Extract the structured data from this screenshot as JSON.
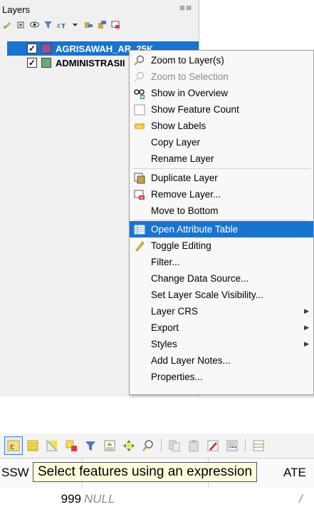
{
  "layers_panel": {
    "title": "Layers",
    "window_controls": "⊠⊠",
    "toolbar_icons": [
      "open-layer-styling-icon",
      "add-group-icon",
      "manage-map-themes-icon",
      "filter-legend-icon",
      "filter-by-expression-icon",
      "expand-all-icon",
      "collapse-all-icon",
      "remove-layer-icon"
    ],
    "layers": [
      {
        "name": "AGRISAWAH_AR_25K",
        "checked": true,
        "swatch_color": "#9b4f96",
        "selected": true
      },
      {
        "name": "ADMINISTRASII",
        "checked": true,
        "swatch_color": "#6cab73",
        "selected": false
      }
    ]
  },
  "context_menu": {
    "items": [
      {
        "label": "Zoom to Layer(s)",
        "icon": "zoom-layer-icon",
        "disabled": false
      },
      {
        "label": "Zoom to Selection",
        "icon": "zoom-selection-icon",
        "disabled": true
      },
      {
        "label": "Show in Overview",
        "icon": "overview-icon",
        "disabled": false
      },
      {
        "label": "Show Feature Count",
        "icon": "checkbox-icon",
        "disabled": false
      },
      {
        "label": "Show Labels",
        "icon": "labels-icon",
        "disabled": false
      },
      {
        "label": "Copy Layer",
        "icon": "",
        "disabled": false
      },
      {
        "label": "Rename Layer",
        "icon": "",
        "disabled": false
      },
      {
        "label": "Duplicate Layer",
        "icon": "duplicate-icon",
        "disabled": false
      },
      {
        "label": "Remove Layer...",
        "icon": "remove-layer-icon",
        "disabled": false
      },
      {
        "label": "Move to Bottom",
        "icon": "",
        "disabled": false
      },
      {
        "label": "Open Attribute Table",
        "icon": "attribute-table-icon",
        "disabled": false,
        "highlighted": true
      },
      {
        "label": "Toggle Editing",
        "icon": "pencil-icon",
        "disabled": false
      },
      {
        "label": "Filter...",
        "icon": "",
        "disabled": false
      },
      {
        "label": "Change Data Source...",
        "icon": "",
        "disabled": false
      },
      {
        "label": "Set Layer Scale Visibility...",
        "icon": "",
        "disabled": false
      },
      {
        "label": "Layer CRS",
        "icon": "",
        "disabled": false,
        "submenu": true
      },
      {
        "label": "Export",
        "icon": "",
        "disabled": false,
        "submenu": true
      },
      {
        "label": "Styles",
        "icon": "",
        "disabled": false,
        "submenu": true
      },
      {
        "label": "Add Layer Notes...",
        "icon": "",
        "disabled": false
      },
      {
        "label": "Properties...",
        "icon": "",
        "disabled": false
      }
    ],
    "submenu_arrow": "▶"
  },
  "attribute_table": {
    "toolbar_icons": [
      "select-by-expression-icon",
      "select-all-icon",
      "invert-selection-icon",
      "deselect-all-icon",
      "filter-select-icon",
      "move-selection-top-icon",
      "pan-to-selection-icon",
      "zoom-to-selection-icon",
      "copy-rows-icon",
      "paste-rows-icon",
      "new-field-icon",
      "field-calculator-icon",
      "conditional-format-icon"
    ],
    "columns": [
      "SSW",
      "",
      "ATE"
    ],
    "row": {
      "number": "999",
      "null_value": "NULL",
      "tail_value": "/"
    },
    "tooltip": "Select features using an expression"
  }
}
